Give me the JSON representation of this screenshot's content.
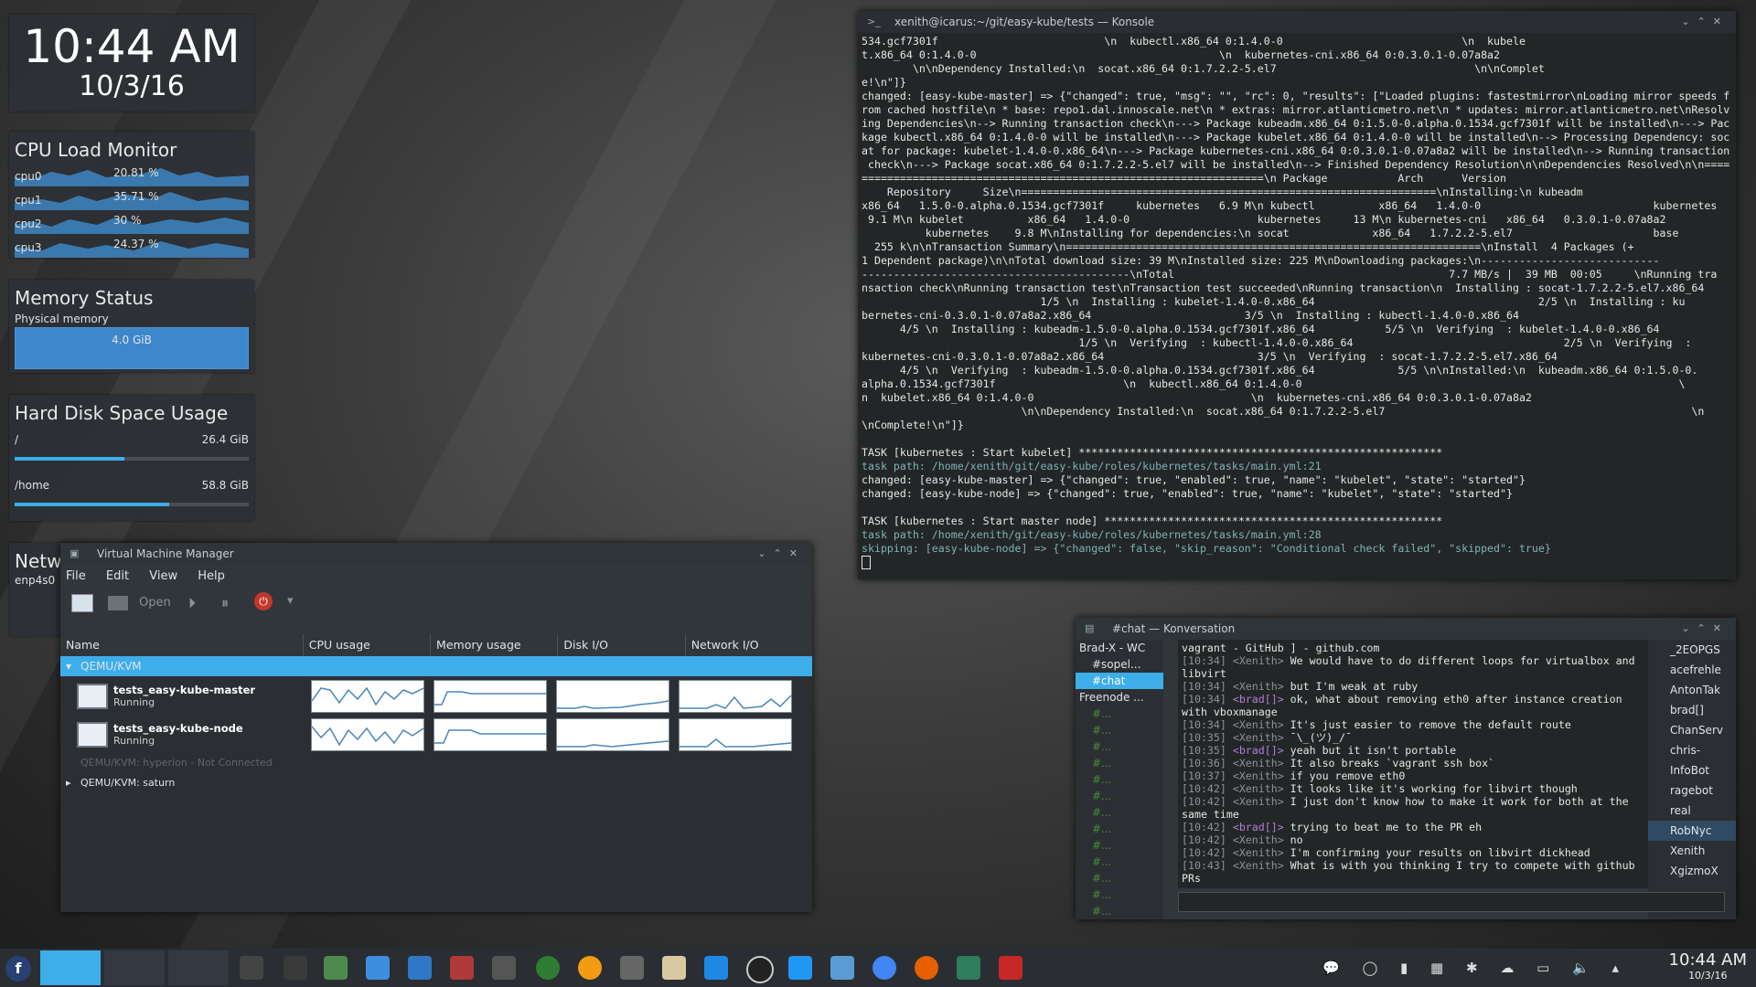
{
  "clock_widget": {
    "time": "10:44 AM",
    "date": "10/3/16"
  },
  "cpu_monitor": {
    "title": "CPU Load Monitor",
    "cpus": [
      {
        "name": "cpu0",
        "load": "20.81 %"
      },
      {
        "name": "cpu1",
        "load": "35.71 %"
      },
      {
        "name": "cpu2",
        "load": "30 %"
      },
      {
        "name": "cpu3",
        "load": "24.37 %"
      }
    ]
  },
  "memory": {
    "title": "Memory Status",
    "label": "Physical memory",
    "value": "4.0 GiB"
  },
  "disk": {
    "title": "Hard Disk Space Usage",
    "mounts": [
      {
        "name": "/",
        "size": "26.4 GiB",
        "used_fraction": 0.47
      },
      {
        "name": "/home",
        "size": "58.8 GiB",
        "used_fraction": 0.66
      }
    ]
  },
  "network": {
    "title": "Netw",
    "iface": "enp4s0"
  },
  "konsole": {
    "title": "xenith@icarus:~/git/easy-kube/tests — Konsole",
    "lines": [
      "534.gcf7301f                          \\n  kubectl.x86_64 0:1.4.0-0                            \\n  kubele",
      "t.x86_64 0:1.4.0-0                                      \\n  kubernetes-cni.x86_64 0:0.3.0.1-0.07a8a2",
      "        \\n\\nDependency Installed:\\n  socat.x86_64 0:1.7.2.2-5.el7                               \\n\\nComplet",
      "e!\\n\"]}",
      "changed: [easy-kube-master] => {\"changed\": true, \"msg\": \"\", \"rc\": 0, \"results\": [\"Loaded plugins: fastestmirror\\nLoading mirror speeds f",
      "rom cached hostfile\\n * base: repo1.dal.innoscale.net\\n * extras: mirror.atlanticmetro.net\\n * updates: mirror.atlanticmetro.net\\nResolv",
      "ing Dependencies\\n--> Running transaction check\\n---> Package kubeadm.x86_64 0:1.5.0-0.alpha.0.1534.gcf7301f will be installed\\n---> Pac",
      "kage kubectl.x86_64 0:1.4.0-0 will be installed\\n---> Package kubelet.x86_64 0:1.4.0-0 will be installed\\n--> Processing Dependency: soc",
      "at for package: kubelet-1.4.0-0.x86_64\\n---> Package kubernetes-cni.x86_64 0:0.3.0.1-0.07a8a2 will be installed\\n--> Running transaction",
      " check\\n---> Package socat.x86_64 0:1.7.2.2-5.el7 will be installed\\n--> Finished Dependency Resolution\\n\\nDependencies Resolved\\n\\n====",
      "===============================================================\\n Package           Arch      Version",
      "    Repository     Size\\n=================================================================\\nInstalling:\\n kubeadm",
      "x86_64   1.5.0-0.alpha.0.1534.gcf7301f     kubernetes   6.9 M\\n kubectl          x86_64   1.4.0-0                           kubernetes",
      " 9.1 M\\n kubelet          x86_64   1.4.0-0                    kubernetes     13 M\\n kubernetes-cni   x86_64   0.3.0.1-0.07a8a2",
      "          kubernetes    9.8 M\\nInstalling for dependencies:\\n socat             x86_64   1.7.2.2-5.el7                      base",
      "  255 k\\n\\nTransaction Summary\\n=================================================================\\nInstall  4 Packages (+",
      "1 Dependent package)\\n\\nTotal download size: 39 M\\nInstalled size: 225 M\\nDownloading packages:\\n----------------------------",
      "------------------------------------------\\nTotal                                           7.7 MB/s |  39 MB  00:05     \\nRunning tra",
      "nsaction check\\nRunning transaction test\\nTransaction test succeeded\\nRunning transaction\\n  Installing : socat-1.7.2.2-5.el7.x86_64",
      "                            1/5 \\n  Installing : kubelet-1.4.0-0.x86_64                                   2/5 \\n  Installing : ku",
      "bernetes-cni-0.3.0.1-0.07a8a2.x86_64                        3/5 \\n  Installing : kubectl-1.4.0-0.x86_64",
      "      4/5 \\n  Installing : kubeadm-1.5.0-0.alpha.0.1534.gcf7301f.x86_64           5/5 \\n  Verifying  : kubelet-1.4.0-0.x86_64",
      "                                  1/5 \\n  Verifying  : kubectl-1.4.0-0.x86_64                                 2/5 \\n  Verifying  :",
      "kubernetes-cni-0.3.0.1-0.07a8a2.x86_64                        3/5 \\n  Verifying  : socat-1.7.2.2-5.el7.x86_64",
      "      4/5 \\n  Verifying  : kubeadm-1.5.0-0.alpha.0.1534.gcf7301f.x86_64             5/5 \\n\\nInstalled:\\n  kubeadm.x86_64 0:1.5.0-0.",
      "alpha.0.1534.gcf7301f                    \\n  kubectl.x86_64 0:1.4.0-0                                                           \\",
      "n  kubelet.x86_64 0:1.4.0-0                                  \\n  kubernetes-cni.x86_64 0:0.3.0.1-0.07a8a2",
      "                         \\n\\nDependency Installed:\\n  socat.x86_64 0:1.7.2.2-5.el7                                                \\n",
      "\\nComplete!\\n\"]}",
      "",
      "TASK [kubernetes : Start kubelet] *********************************************************",
      "task path: /home/xenith/git/easy-kube/roles/kubernetes/tasks/main.yml:21",
      "changed: [easy-kube-master] => {\"changed\": true, \"enabled\": true, \"name\": \"kubelet\", \"state\": \"started\"}",
      "changed: [easy-kube-node] => {\"changed\": true, \"enabled\": true, \"name\": \"kubelet\", \"state\": \"started\"}",
      "",
      "TASK [kubernetes : Start master node] *****************************************************",
      "task path: /home/xenith/git/easy-kube/roles/kubernetes/tasks/main.yml:28",
      "skipping: [easy-kube-node] => {\"changed\": false, \"skip_reason\": \"Conditional check failed\", \"skipped\": true}"
    ]
  },
  "vmm": {
    "title": "Virtual Machine Manager",
    "menu": [
      "File",
      "Edit",
      "View",
      "Help"
    ],
    "open_label": "Open",
    "columns": [
      "Name",
      "CPU usage",
      "Memory usage",
      "Disk I/O",
      "Network I/O"
    ],
    "group": "QEMU/KVM",
    "vms": [
      {
        "name": "tests_easy-kube-master",
        "status": "Running"
      },
      {
        "name": "tests_easy-kube-node",
        "status": "Running"
      }
    ],
    "disconnected": "QEMU/KVM: hyperion - Not Connected",
    "saturn": "QEMU/KVM: saturn"
  },
  "konversation": {
    "title": "#chat — Konversation",
    "servers": [
      {
        "name": "Brad-X - WC",
        "channels": [
          "#sopel...",
          "#chat"
        ]
      },
      {
        "name": "Freenode ...",
        "channels": [
          "#...",
          "#...",
          "#...",
          "#...",
          "#...",
          "#...",
          "#...",
          "#...",
          "#...",
          "#...",
          "#...",
          "#...",
          "#..."
        ]
      }
    ],
    "messages": [
      {
        "ts": "",
        "nick": "",
        "text": "vagrant - GitHub ] - github.com"
      },
      {
        "ts": "[10:34]",
        "nick": "Xenith",
        "text": "We would have to do different loops for virtualbox and libvirt"
      },
      {
        "ts": "[10:34]",
        "nick": "Xenith",
        "text": "but I'm weak at ruby"
      },
      {
        "ts": "[10:34]",
        "nick": "brad[]",
        "text": "ok, what about removing eth0 after instance creation with vboxmanage"
      },
      {
        "ts": "[10:34]",
        "nick": "Xenith",
        "text": "It's just easier to remove the default route"
      },
      {
        "ts": "[10:35]",
        "nick": "Xenith",
        "text": "¯\\_(ツ)_/¯"
      },
      {
        "ts": "[10:35]",
        "nick": "brad[]",
        "text": "yeah but it isn't portable"
      },
      {
        "ts": "[10:36]",
        "nick": "Xenith",
        "text": "It also breaks `vagrant ssh box`"
      },
      {
        "ts": "[10:37]",
        "nick": "Xenith",
        "text": "if you remove eth0"
      },
      {
        "ts": "[10:42]",
        "nick": "Xenith",
        "text": "It looks like it's working for libvirt though"
      },
      {
        "ts": "[10:42]",
        "nick": "Xenith",
        "text": "I just don't know how to make it work for both at the same time"
      },
      {
        "ts": "[10:42]",
        "nick": "brad[]",
        "text": "trying to beat me to the PR eh"
      },
      {
        "ts": "[10:42]",
        "nick": "Xenith",
        "text": "no"
      },
      {
        "ts": "[10:42]",
        "nick": "Xenith",
        "text": "I'm confirming your results on libvirt dickhead"
      },
      {
        "ts": "[10:43]",
        "nick": "Xenith",
        "text": "What is with you thinking I try to compete with github PRs"
      }
    ],
    "nicks": [
      "_2EOPGS",
      "acefrehle",
      "AntonTak",
      "brad[]",
      "ChanServ",
      "chris-",
      "InfoBot",
      "ragebot",
      "real",
      "RobNyc",
      "Xenith",
      "XgizmoX"
    ]
  },
  "taskbar": {
    "time": "10:44 AM",
    "date": "10/3/16"
  },
  "colors": {
    "accent": "#3daee9",
    "panel": "#31363b"
  }
}
